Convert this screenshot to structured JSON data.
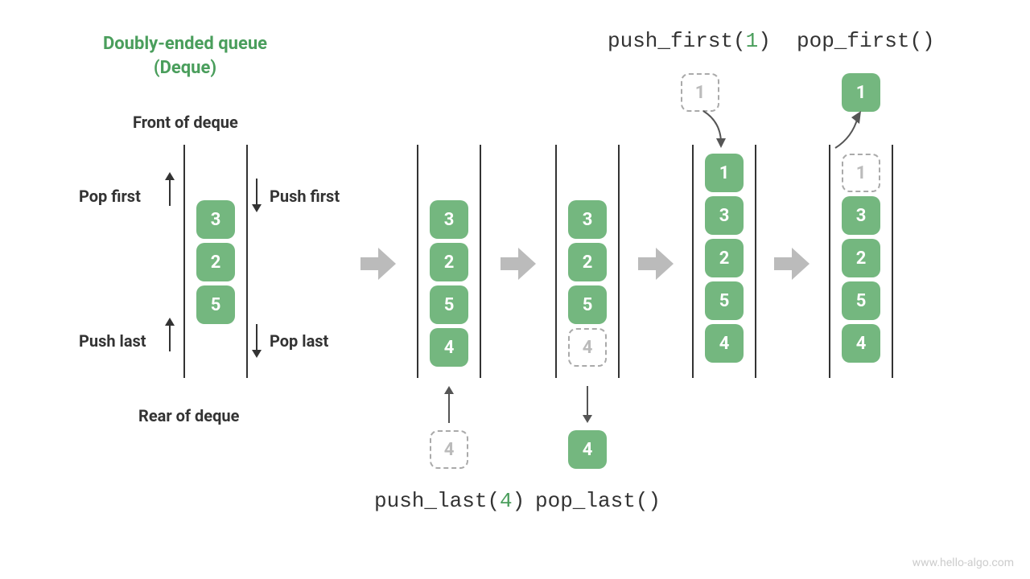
{
  "title": {
    "line1": "Doubly-ended queue",
    "line2": "(Deque)"
  },
  "labels": {
    "front": "Front of deque",
    "rear": "Rear of deque",
    "pop_first": "Pop first",
    "push_first": "Push first",
    "push_last": "Push last",
    "pop_last": "Pop last"
  },
  "ops": {
    "push_first": {
      "name": "push_first",
      "arg": "1"
    },
    "pop_first": {
      "name": "pop_first",
      "arg": ""
    },
    "push_last": {
      "name": "push_last",
      "arg": "4"
    },
    "pop_last": {
      "name": "pop_last",
      "arg": ""
    }
  },
  "columns": [
    {
      "cells": [
        "3",
        "2",
        "5"
      ],
      "leading_spacers": 1,
      "ghost_idx": -1
    },
    {
      "cells": [
        "3",
        "2",
        "5",
        "4"
      ],
      "leading_spacers": 1,
      "ghost_idx": -1
    },
    {
      "cells": [
        "3",
        "2",
        "5",
        "4"
      ],
      "leading_spacers": 1,
      "ghost_idx": 3
    },
    {
      "cells": [
        "1",
        "3",
        "2",
        "5",
        "4"
      ],
      "leading_spacers": 0,
      "ghost_idx": -1
    },
    {
      "cells": [
        "1",
        "3",
        "2",
        "5",
        "4"
      ],
      "leading_spacers": 0,
      "ghost_idx": 0
    }
  ],
  "floating": {
    "push_last_ghost": "4",
    "pop_last_solid": "4",
    "push_first_ghost": "1",
    "pop_first_solid": "1"
  },
  "attribution": "www.hello-algo.com"
}
